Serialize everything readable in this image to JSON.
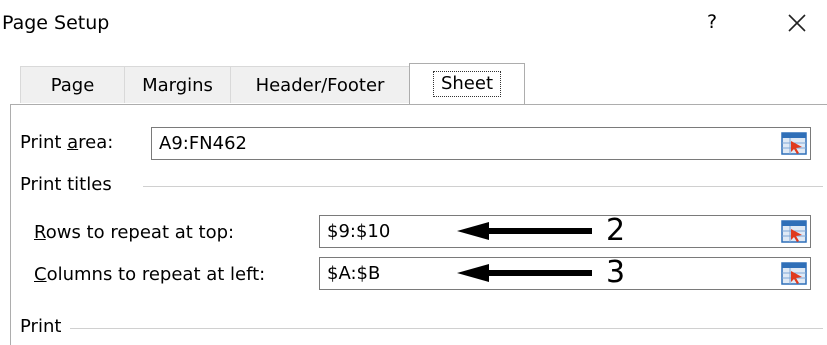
{
  "dialog": {
    "title": "Page Setup",
    "help_label": "?",
    "close_icon": "close-icon"
  },
  "tabs": [
    {
      "label": "Page"
    },
    {
      "label": "Margins"
    },
    {
      "label": "Header/Footer"
    },
    {
      "label": "Sheet",
      "active": true
    }
  ],
  "sheet": {
    "print_area": {
      "label_pre": "Print ",
      "label_accel": "a",
      "label_post": "rea:",
      "value": "A9:FN462"
    },
    "print_titles_header": "Print titles",
    "rows_repeat": {
      "label_accel": "R",
      "label_post": "ows to repeat at top:",
      "value": "$9:$10"
    },
    "cols_repeat": {
      "label_accel": "C",
      "label_post": "olumns to repeat at left:",
      "value": "$A:$B"
    },
    "print_header": "Print"
  },
  "annotations": {
    "rows_number": "2",
    "cols_number": "3"
  },
  "colors": {
    "ref_button_blue": "#2f6fb8",
    "ref_button_red": "#e03a1e"
  }
}
